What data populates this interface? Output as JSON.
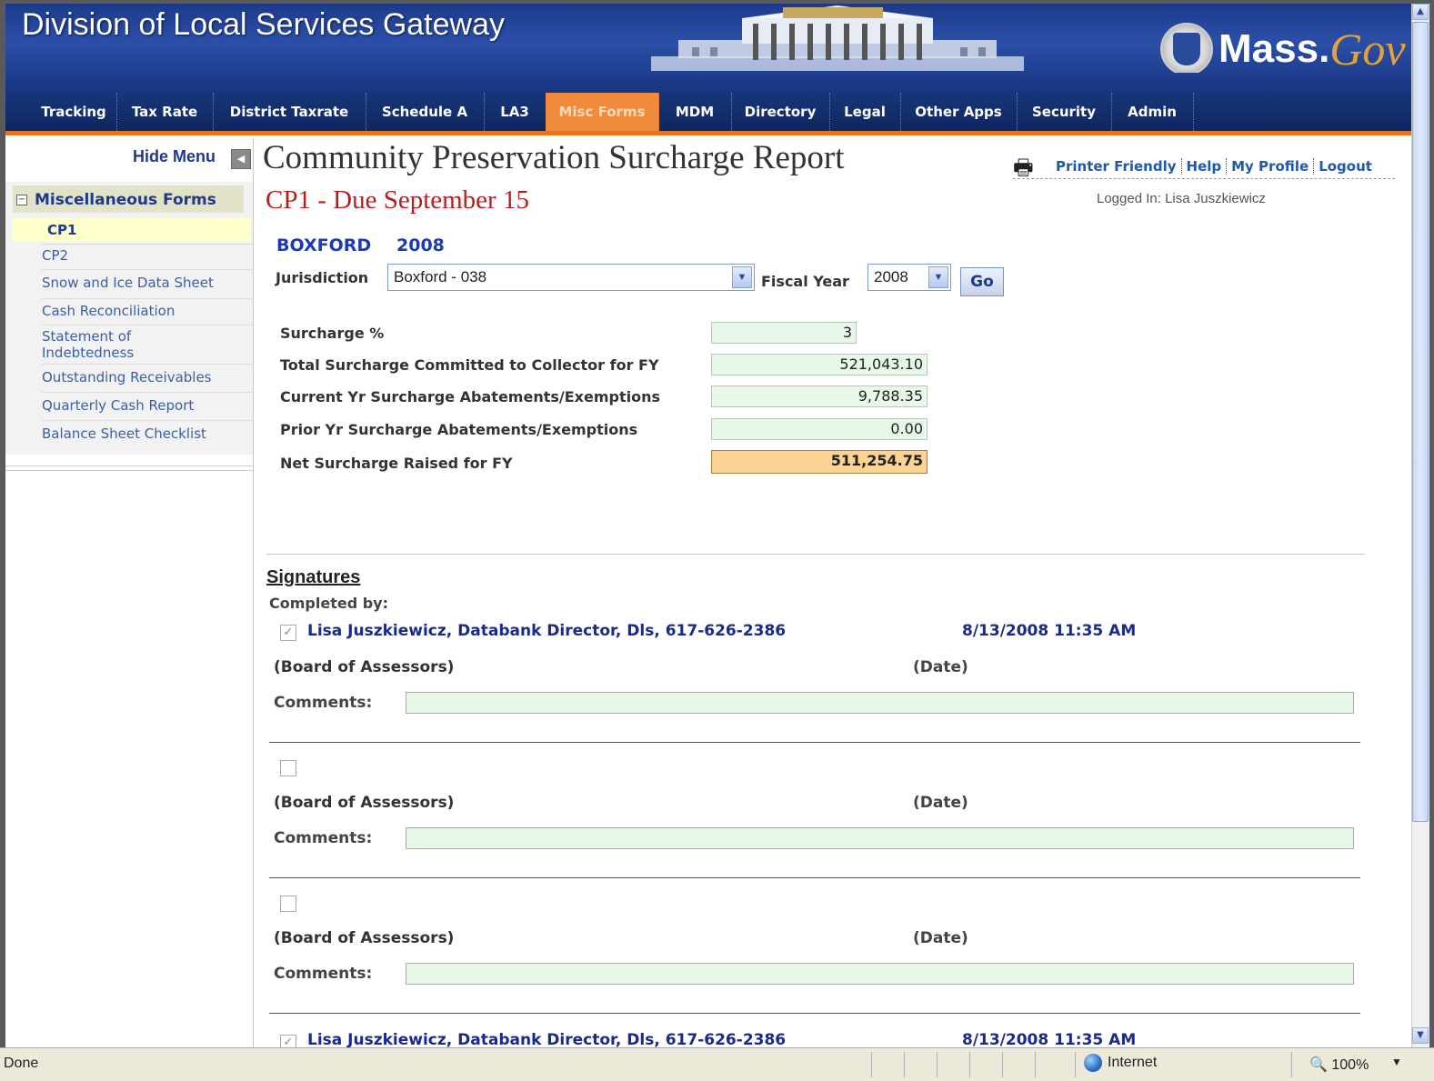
{
  "header": {
    "title": "Division of Local Services Gateway",
    "brand_mass": "Mass.",
    "brand_gov": "Gov"
  },
  "nav": {
    "items": [
      {
        "label": "Tracking"
      },
      {
        "label": "Tax Rate"
      },
      {
        "label": "District Taxrate"
      },
      {
        "label": "Schedule A"
      },
      {
        "label": "LA3"
      },
      {
        "label": "Misc Forms"
      },
      {
        "label": "MDM"
      },
      {
        "label": "Directory"
      },
      {
        "label": "Legal"
      },
      {
        "label": "Other Apps"
      },
      {
        "label": "Security"
      },
      {
        "label": "Admin"
      }
    ],
    "active": "Misc Forms"
  },
  "sidebar": {
    "hide_menu": "Hide Menu",
    "section": "Miscellaneous Forms",
    "items": [
      {
        "label": "CP1"
      },
      {
        "label": "CP2"
      },
      {
        "label": "Snow and Ice Data Sheet"
      },
      {
        "label": "Cash Reconciliation"
      },
      {
        "label": "Statement of Indebtedness"
      },
      {
        "label": "Outstanding Receivables"
      },
      {
        "label": "Quarterly Cash Report"
      },
      {
        "label": "Balance Sheet Checklist"
      }
    ]
  },
  "page": {
    "title": "Community Preservation Surcharge Report",
    "subtitle": "CP1 - Due September 15",
    "links": [
      "Printer Friendly",
      "Help",
      "My Profile",
      "Logout"
    ],
    "logged_in": "Logged In: Lisa Juszkiewicz",
    "town": "BOXFORD",
    "year": "2008"
  },
  "filters": {
    "jurisdiction_label": "Jurisdiction",
    "jurisdiction_value": "Boxford - 038",
    "fiscal_year_label": "Fiscal Year",
    "fiscal_year_value": "2008",
    "go_label": "Go"
  },
  "form": {
    "rows": [
      {
        "label": "Surcharge %",
        "value": "3"
      },
      {
        "label": "Total Surcharge Committed to Collector for FY",
        "value": "521,043.10"
      },
      {
        "label": "Current Yr Surcharge Abatements/Exemptions",
        "value": "9,788.35"
      },
      {
        "label": "Prior Yr Surcharge Abatements/Exemptions",
        "value": "0.00"
      },
      {
        "label": "Net Surcharge Raised for FY",
        "value": "511,254.75"
      }
    ]
  },
  "signatures": {
    "title": "Signatures",
    "completed_by": "Completed by:",
    "board_label": "(Board of Assessors)",
    "date_label": "(Date)",
    "comments_label": "Comments:",
    "blocks": [
      {
        "checked": true,
        "signer": "Lisa Juszkiewicz, Databank Director, Dls, 617-626-2386",
        "date": "8/13/2008 11:35 AM"
      },
      {
        "checked": false,
        "signer": "",
        "date": ""
      },
      {
        "checked": false,
        "signer": "",
        "date": ""
      },
      {
        "checked": true,
        "signer": "Lisa Juszkiewicz, Databank Director, Dls, 617-626-2386",
        "date": "8/13/2008 11:35 AM"
      }
    ]
  },
  "statusbar": {
    "status": "Done",
    "zone": "Internet",
    "zoom": "100%"
  },
  "icons": {
    "printer": "printer-icon",
    "hide_menu": "collapse-left-icon",
    "globe": "globe-icon",
    "zoom": "magnifier-icon"
  }
}
